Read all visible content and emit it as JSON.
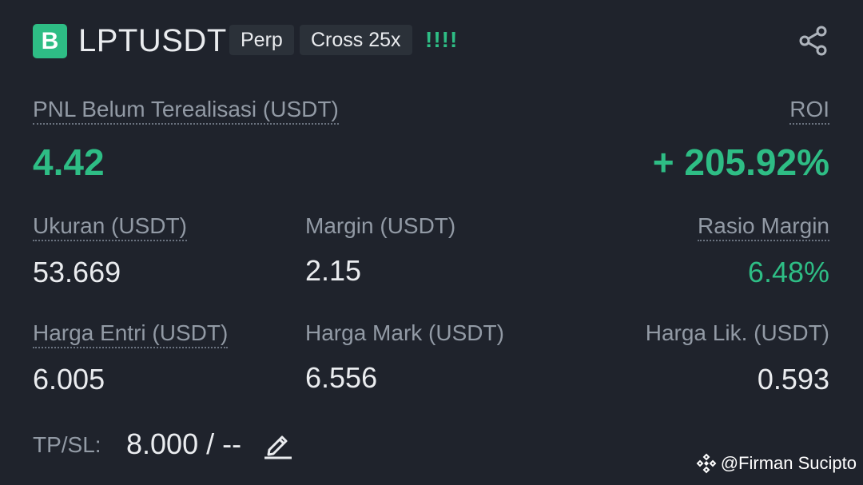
{
  "header": {
    "side_badge": "B",
    "symbol": "LPTUSDT",
    "tag_type": "Perp",
    "tag_margin": "Cross 25x",
    "leverage_indicator": "!!!!",
    "share_icon": "share-icon"
  },
  "pnl": {
    "label": "PNL Belum Terealisasi (USDT)",
    "value": "4.42"
  },
  "roi": {
    "label": "ROI",
    "value": "+ 205.92%"
  },
  "stats": {
    "size_label": "Ukuran (USDT)",
    "size_value": "53.669",
    "margin_label": "Margin (USDT)",
    "margin_value": "2.15",
    "margin_ratio_label": "Rasio Margin",
    "margin_ratio_value": "6.48%",
    "entry_label": "Harga Entri (USDT)",
    "entry_value": "6.005",
    "mark_label": "Harga Mark (USDT)",
    "mark_value": "6.556",
    "liq_label": "Harga Lik. (USDT)",
    "liq_value": "0.593"
  },
  "tpsl": {
    "label": "TP/SL:",
    "value": "8.000 / --",
    "edit_icon": "edit-icon"
  },
  "watermark": {
    "text": "@Firman Sucipto",
    "icon": "binance-diamond-icon"
  },
  "colors": {
    "background": "#1f232c",
    "green": "#2ebd85",
    "label_gray": "#929aa5",
    "text": "#eaecef",
    "tag_bg": "#2b3139"
  }
}
